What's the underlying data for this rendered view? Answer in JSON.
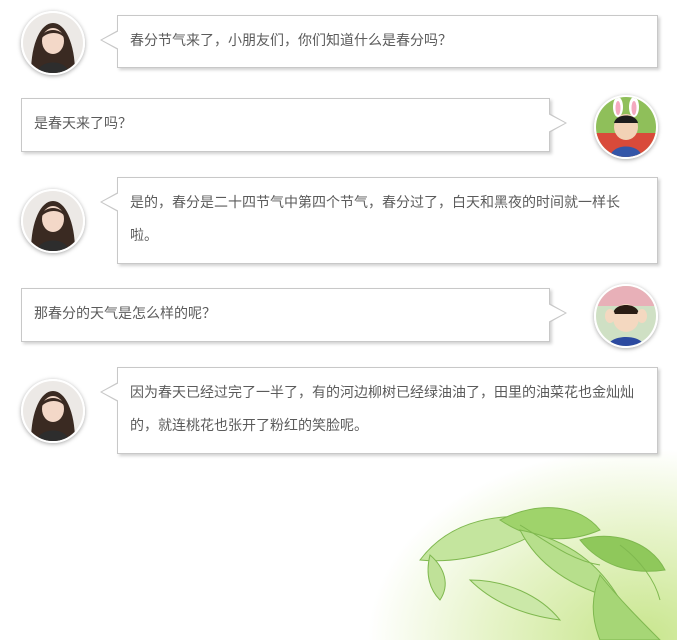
{
  "messages": [
    {
      "speaker": "teacher",
      "text": "春分节气来了，小朋友们，你们知道什么是春分吗？"
    },
    {
      "speaker": "child-1",
      "text": "是春天来了吗？"
    },
    {
      "speaker": "teacher",
      "text": "是的，春分是二十四节气中第四个节气，春分过了，白天和黑夜的时间就一样长啦。"
    },
    {
      "speaker": "child-2",
      "text": "那春分的天气是怎么样的呢？"
    },
    {
      "speaker": "teacher",
      "text": "因为春天已经过完了一半了，有的河边柳树已经绿油油了，田里的油菜花也金灿灿的，就连桃花也张开了粉红的笑脸呢。"
    }
  ],
  "colors": {
    "bubble_border": "#c8c8c8",
    "text": "#5b5b5b",
    "leaf_green": "#9ccf6a",
    "wash_green": "#d6eca5"
  },
  "icons": {
    "teacher_avatar": "teacher-avatar",
    "child_avatar": "child-avatar",
    "decoration": "spring-leaves"
  }
}
